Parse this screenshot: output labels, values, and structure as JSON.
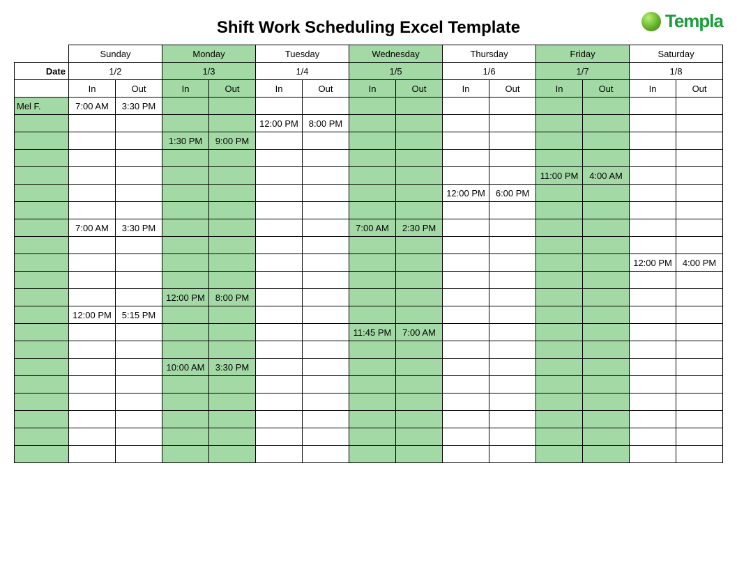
{
  "title": "Shift Work Scheduling Excel Template",
  "logo_text": "Templa",
  "date_label": "Date",
  "in_label": "In",
  "out_label": "Out",
  "days": [
    {
      "name": "Sunday",
      "date": "1/2",
      "shaded": false
    },
    {
      "name": "Monday",
      "date": "1/3",
      "shaded": true
    },
    {
      "name": "Tuesday",
      "date": "1/4",
      "shaded": false
    },
    {
      "name": "Wednesday",
      "date": "1/5",
      "shaded": true
    },
    {
      "name": "Thursday",
      "date": "1/6",
      "shaded": false
    },
    {
      "name": "Friday",
      "date": "1/7",
      "shaded": true
    },
    {
      "name": "Saturday",
      "date": "1/8",
      "shaded": false
    }
  ],
  "rows": [
    {
      "name": "Mel F.",
      "cells": [
        "7:00 AM",
        "3:30 PM",
        "",
        "",
        "",
        "",
        "",
        "",
        "",
        "",
        "",
        "",
        "",
        ""
      ]
    },
    {
      "name": "",
      "cells": [
        "",
        "",
        "",
        "",
        "12:00 PM",
        "8:00 PM",
        "",
        "",
        "",
        "",
        "",
        "",
        "",
        ""
      ]
    },
    {
      "name": "",
      "cells": [
        "",
        "",
        "1:30 PM",
        "9:00 PM",
        "",
        "",
        "",
        "",
        "",
        "",
        "",
        "",
        "",
        ""
      ]
    },
    {
      "name": "",
      "cells": [
        "",
        "",
        "",
        "",
        "",
        "",
        "",
        "",
        "",
        "",
        "",
        "",
        "",
        ""
      ]
    },
    {
      "name": "",
      "cells": [
        "",
        "",
        "",
        "",
        "",
        "",
        "",
        "",
        "",
        "",
        "11:00 PM",
        "4:00 AM",
        "",
        ""
      ]
    },
    {
      "name": "",
      "cells": [
        "",
        "",
        "",
        "",
        "",
        "",
        "",
        "",
        "12:00 PM",
        "6:00 PM",
        "",
        "",
        "",
        ""
      ]
    },
    {
      "name": "",
      "cells": [
        "",
        "",
        "",
        "",
        "",
        "",
        "",
        "",
        "",
        "",
        "",
        "",
        "",
        ""
      ]
    },
    {
      "name": "",
      "cells": [
        "7:00 AM",
        "3:30 PM",
        "",
        "",
        "",
        "",
        "7:00 AM",
        "2:30 PM",
        "",
        "",
        "",
        "",
        "",
        ""
      ]
    },
    {
      "name": "",
      "cells": [
        "",
        "",
        "",
        "",
        "",
        "",
        "",
        "",
        "",
        "",
        "",
        "",
        "",
        ""
      ]
    },
    {
      "name": "",
      "cells": [
        "",
        "",
        "",
        "",
        "",
        "",
        "",
        "",
        "",
        "",
        "",
        "",
        "12:00 PM",
        "4:00 PM"
      ]
    },
    {
      "name": "",
      "cells": [
        "",
        "",
        "",
        "",
        "",
        "",
        "",
        "",
        "",
        "",
        "",
        "",
        "",
        ""
      ]
    },
    {
      "name": "",
      "cells": [
        "",
        "",
        "12:00 PM",
        "8:00 PM",
        "",
        "",
        "",
        "",
        "",
        "",
        "",
        "",
        "",
        ""
      ]
    },
    {
      "name": "",
      "cells": [
        "12:00 PM",
        "5:15 PM",
        "",
        "",
        "",
        "",
        "",
        "",
        "",
        "",
        "",
        "",
        "",
        ""
      ]
    },
    {
      "name": "",
      "cells": [
        "",
        "",
        "",
        "",
        "",
        "",
        "11:45 PM",
        "7:00 AM",
        "",
        "",
        "",
        "",
        "",
        ""
      ]
    },
    {
      "name": "",
      "cells": [
        "",
        "",
        "",
        "",
        "",
        "",
        "",
        "",
        "",
        "",
        "",
        "",
        "",
        ""
      ]
    },
    {
      "name": "",
      "cells": [
        "",
        "",
        "10:00 AM",
        "3:30 PM",
        "",
        "",
        "",
        "",
        "",
        "",
        "",
        "",
        "",
        ""
      ]
    },
    {
      "name": "",
      "cells": [
        "",
        "",
        "",
        "",
        "",
        "",
        "",
        "",
        "",
        "",
        "",
        "",
        "",
        ""
      ]
    },
    {
      "name": "",
      "cells": [
        "",
        "",
        "",
        "",
        "",
        "",
        "",
        "",
        "",
        "",
        "",
        "",
        "",
        ""
      ]
    },
    {
      "name": "",
      "cells": [
        "",
        "",
        "",
        "",
        "",
        "",
        "",
        "",
        "",
        "",
        "",
        "",
        "",
        ""
      ]
    },
    {
      "name": "",
      "cells": [
        "",
        "",
        "",
        "",
        "",
        "",
        "",
        "",
        "",
        "",
        "",
        "",
        "",
        ""
      ]
    },
    {
      "name": "",
      "cells": [
        "",
        "",
        "",
        "",
        "",
        "",
        "",
        "",
        "",
        "",
        "",
        "",
        "",
        ""
      ]
    }
  ]
}
